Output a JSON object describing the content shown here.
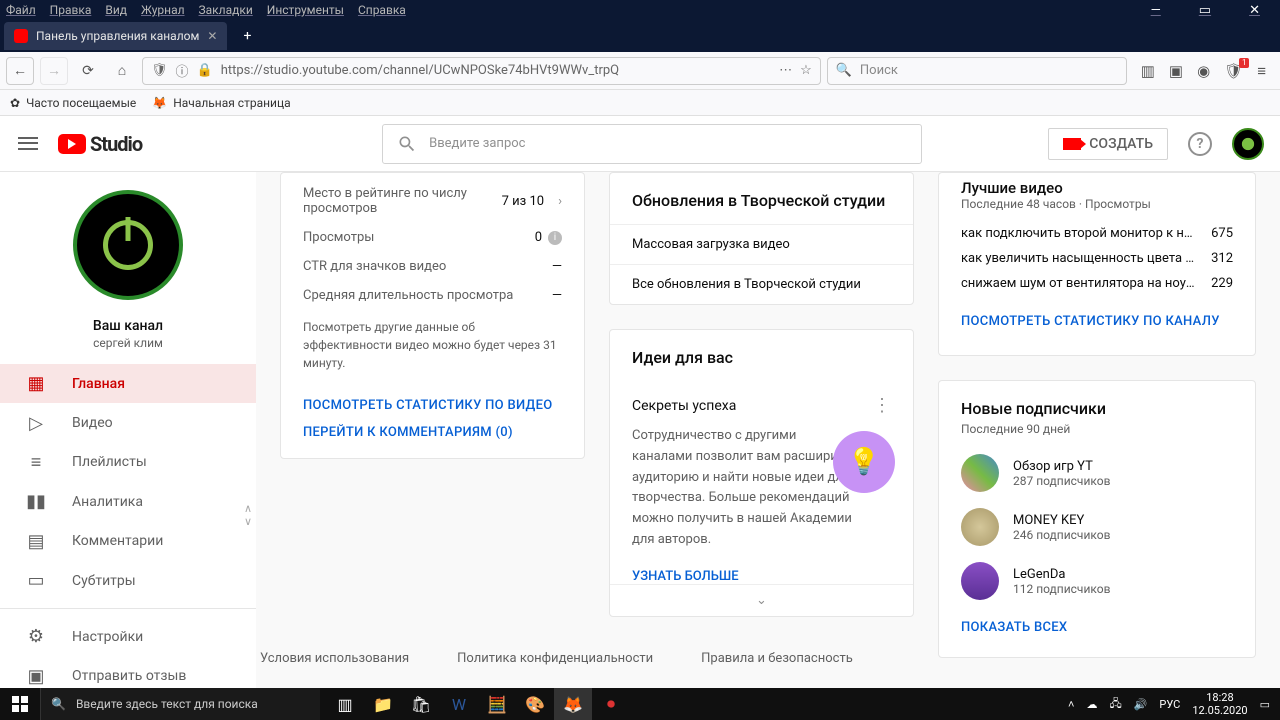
{
  "browser": {
    "menus": [
      "Файл",
      "Правка",
      "Вид",
      "Журнал",
      "Закладки",
      "Инструменты",
      "Справка"
    ],
    "tab_title": "Панель управления каналом",
    "url": "https://studio.youtube.com/channel/UCwNPOSke74bHVt9WWv_trpQ",
    "search_placeholder": "Поиск",
    "bookmarks": {
      "frequent": "Часто посещаемые",
      "home": "Начальная страница"
    }
  },
  "yt": {
    "logo_text": "Studio",
    "search_placeholder": "Введите запрос",
    "create": "СОЗДАТЬ"
  },
  "channel": {
    "title": "Ваш канал",
    "owner": "сергей клим"
  },
  "nav": {
    "home": "Главная",
    "video": "Видео",
    "playlists": "Плейлисты",
    "analytics": "Аналитика",
    "comments": "Комментарии",
    "subtitles": "Субтитры",
    "settings": "Настройки",
    "feedback": "Отправить отзыв"
  },
  "stats": {
    "rank": {
      "label": "Место в рейтинге по числу просмотров",
      "value": "7 из 10"
    },
    "views": {
      "label": "Просмотры",
      "value": "0"
    },
    "ctr": {
      "label": "CTR для значков видео",
      "value": "—"
    },
    "duration": {
      "label": "Средняя длительность просмотра",
      "value": "—"
    },
    "note": "Посмотреть другие данные об эффективности видео можно будет через 31 минуту.",
    "link_stats": "ПОСМОТРЕТЬ СТАТИСТИКУ ПО ВИДЕО",
    "link_comments": "ПЕРЕЙТИ К КОММЕНТАРИЯМ (0)"
  },
  "updates": {
    "title": "Обновления в Творческой студии",
    "row1": "Массовая загрузка видео",
    "row2": "Все обновления в Творческой студии"
  },
  "ideas": {
    "title": "Идеи для вас",
    "sub": "Секреты успеха",
    "text": "Сотрудничество с другими каналами позволит вам расширить аудиторию и найти новые идеи для творчества. Больше рекомендаций можно получить в нашей Академии для авторов.",
    "link": "УЗНАТЬ БОЛЬШЕ"
  },
  "top": {
    "title": "Лучшие видео",
    "sub": "Последние 48 часов · Просмотры",
    "videos": [
      {
        "t": "как подключить второй монитор к ноутбуку",
        "v": "675"
      },
      {
        "t": "как увеличить насыщенность цвета на экране но...",
        "v": "312"
      },
      {
        "t": "снижаем шум от вентилятора на ноутбуке",
        "v": "229"
      }
    ],
    "link": "ПОСМОТРЕТЬ СТАТИСТИКУ ПО КАНАЛУ"
  },
  "subs": {
    "title": "Новые подписчики",
    "sub": "Последние 90 дней",
    "list": [
      {
        "name": "Обзор игр YT",
        "count": "287 подписчиков",
        "color": "#a04fb8"
      },
      {
        "name": "MONEY KEY",
        "count": "246 подписчиков",
        "color": "#c9b88a"
      },
      {
        "name": "LeGenDa",
        "count": "112 подписчиков",
        "color": "#7a3fb5"
      }
    ],
    "link": "ПОКАЗАТЬ ВСЕХ"
  },
  "footer": {
    "terms": "Условия использования",
    "privacy": "Политика конфиденциальности",
    "rules": "Правила и безопасность"
  },
  "taskbar": {
    "search": "Введите здесь текст для поиска",
    "lang": "РУС",
    "time": "18:28",
    "date": "12.05.2020"
  }
}
